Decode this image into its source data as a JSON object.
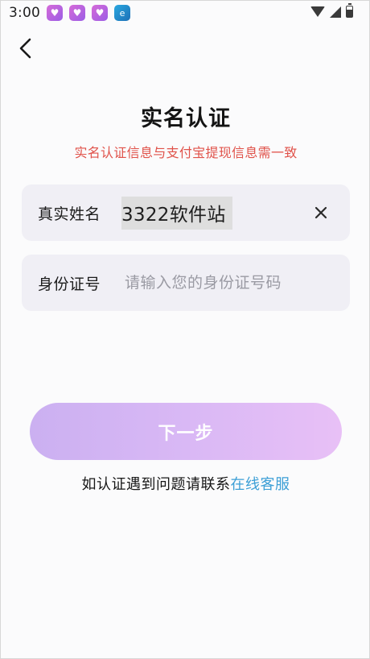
{
  "status_bar": {
    "time": "3:00",
    "app_icons": [
      {
        "name": "heart-app-icon",
        "glyph": "♥",
        "color": "#c862d8"
      },
      {
        "name": "heart-app-icon",
        "glyph": "♥",
        "color": "#c862d8"
      },
      {
        "name": "heart-app-icon",
        "glyph": "♥",
        "color": "#c862d8"
      },
      {
        "name": "browser-app-icon",
        "glyph": "e",
        "color": "#2a8fd0"
      }
    ],
    "icons": [
      "wifi-icon",
      "signal-icon",
      "battery-icon"
    ]
  },
  "header": {
    "back_icon": "chevron-left-icon",
    "title": "实名认证",
    "notice": "实名认证信息与支付宝提现信息需一致",
    "notice_color": "#e0524a"
  },
  "form": {
    "name_field": {
      "label": "真实姓名",
      "value": "3322软件站",
      "clear_icon": "close-icon"
    },
    "id_field": {
      "label": "身份证号",
      "value": "",
      "placeholder": "请输入您的身份证号码"
    }
  },
  "actions": {
    "next_label": "下一步",
    "button_gradient": [
      "#cbb0f1",
      "#e8c0f6"
    ]
  },
  "help": {
    "prefix": "如认证遇到问题请联系",
    "link": "在线客服",
    "link_color": "#3c9fd6"
  }
}
